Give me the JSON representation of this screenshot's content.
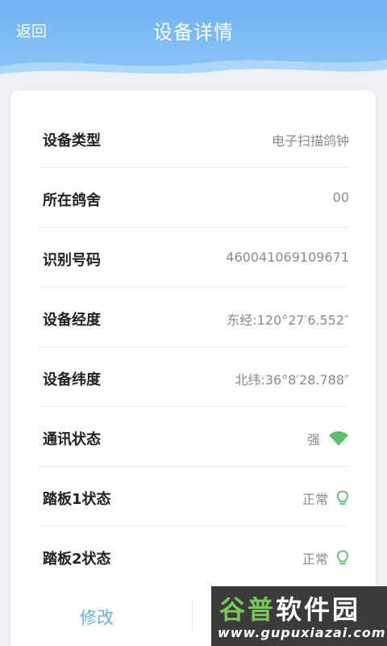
{
  "header": {
    "back_label": "返回",
    "title": "设备详情"
  },
  "rows": [
    {
      "label": "设备类型",
      "value": "电子扫描鸽钟"
    },
    {
      "label": "所在鸽舍",
      "value": "00"
    },
    {
      "label": "识别号码",
      "value": "460041069109671"
    },
    {
      "label": "设备经度",
      "value": "东经:120°27′6.552″"
    },
    {
      "label": "设备纬度",
      "value": "北纬:36°8′28.788″"
    },
    {
      "label": "通讯状态",
      "value": "强",
      "icon": "wifi-signal-icon"
    },
    {
      "label": "踏板1状态",
      "value": "正常",
      "icon": "lightbulb-icon"
    },
    {
      "label": "踏板2状态",
      "value": "正常",
      "icon": "lightbulb-icon"
    }
  ],
  "footer": {
    "edit_label": "修改"
  },
  "watermark": {
    "title_part1": "谷普",
    "title_part2": "软件园",
    "url": "www.gupuxiazai.com"
  },
  "colors": {
    "header": "#6fb2f2",
    "accent": "#62aee6",
    "status_green": "#5bbf6b"
  }
}
